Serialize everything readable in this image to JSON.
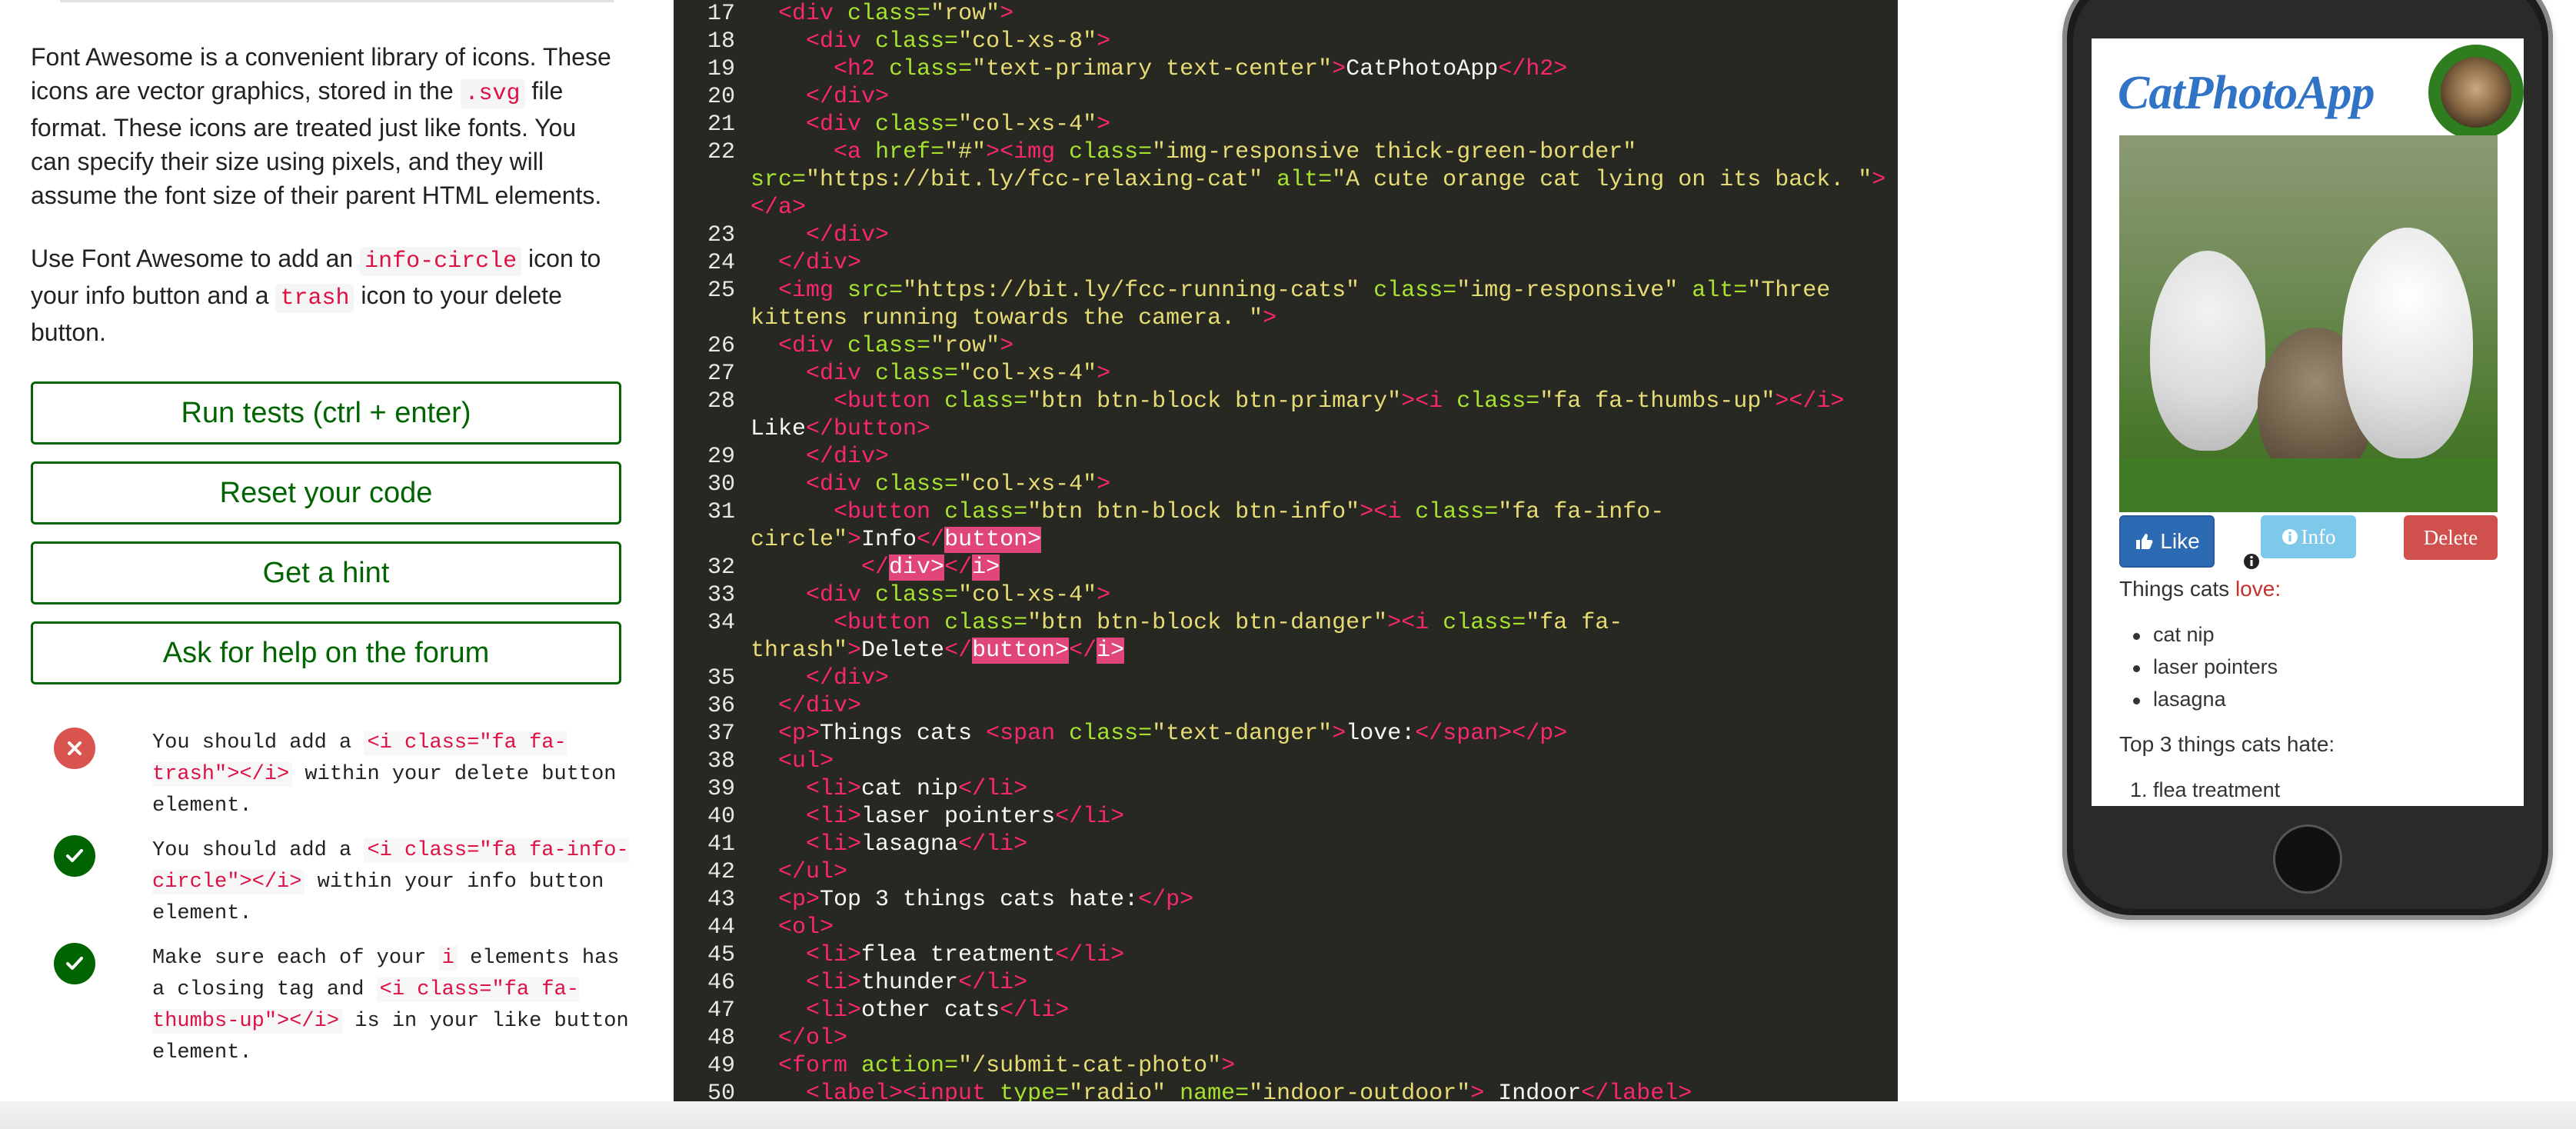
{
  "instructions": {
    "para1": {
      "before": "Font Awesome is a convenient library of icons. These icons are vector graphics, stored in the ",
      "code": ".svg",
      "after": " file format. These icons are treated just like fonts. You can specify their size using pixels, and they will assume the font size of their parent HTML elements."
    },
    "para2": {
      "p1": "Use Font Awesome to add an ",
      "code1": "info-circle",
      "p2": " icon to your info button and a ",
      "code2": "trash",
      "p3": " icon to your delete button."
    }
  },
  "buttons": {
    "run_tests": "Run tests (ctrl + enter)",
    "reset_code": "Reset your code",
    "get_hint": "Get a hint",
    "ask_forum": "Ask for help on the forum"
  },
  "tests": [
    {
      "status": "fail",
      "pre": "You should add a ",
      "code": "<i class=\"fa fa-trash\"></i>",
      "post": " within your delete button element."
    },
    {
      "status": "pass",
      "pre": "You should add a ",
      "code": "<i class=\"fa fa-info-circle\"></i>",
      "post": " within your info button element."
    },
    {
      "status": "pass",
      "pre": "Make sure each of your ",
      "code": "i",
      "mid": " elements has a closing tag and ",
      "code2": "<i class=\"fa fa-thumbs-up\"></i>",
      "post": " is in your like button element."
    }
  ],
  "editor": {
    "line_numbers": [
      "17",
      "18",
      "19",
      "20",
      "21",
      "22",
      "",
      "",
      "23",
      "24",
      "25",
      "",
      "26",
      "27",
      "28",
      "",
      "29",
      "30",
      "31",
      "",
      "32",
      "33",
      "34",
      "",
      "35",
      "36",
      "37",
      "38",
      "39",
      "40",
      "41",
      "42",
      "43",
      "44",
      "45",
      "46",
      "47",
      "48",
      "49",
      "50"
    ]
  },
  "preview": {
    "app_title": "CatPhotoApp",
    "like_label": "Like",
    "info_label": "Info",
    "delete_label": "Delete",
    "things_love_prefix": "Things cats ",
    "things_love_word": "love:",
    "love_list": [
      "cat nip",
      "laser pointers",
      "lasagna"
    ],
    "hate_heading": "Top 3 things cats hate:",
    "hate_list_first": "1. flea treatment"
  },
  "colors": {
    "accent_green": "#006400",
    "editor_bg": "#272822",
    "tag_pink": "#f92672",
    "attr_green": "#a6e22e",
    "string_yellow": "#e6db74",
    "highlight": "#e0457b",
    "app_title_blue": "#3174c6"
  }
}
